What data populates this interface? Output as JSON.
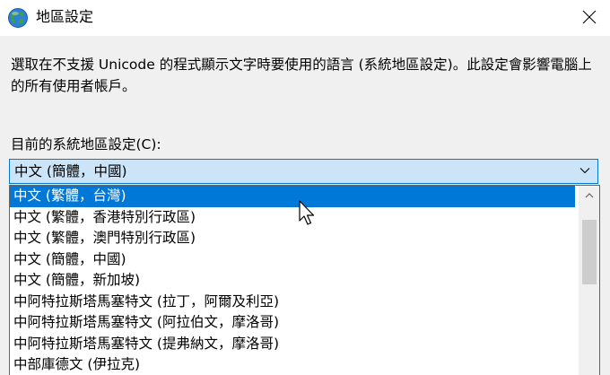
{
  "window": {
    "title": "地區設定",
    "app_icon": "globe-icon",
    "close_icon": "close-icon"
  },
  "description": "選取在不支援 Unicode 的程式顯示文字時要使用的語言 (系統地區設定)。此設定會影響電腦上的所有使用者帳戶。",
  "combo": {
    "label": "目前的系統地區設定(C):",
    "value": "中文 (簡體，中國)",
    "arrow_icon": "chevron-down-icon"
  },
  "dropdown": {
    "selected_index": 0,
    "options": [
      "中文 (繁體，台灣)",
      "中文 (繁體，香港特別行政區)",
      "中文 (繁體，澳門特別行政區)",
      "中文 (簡體，中國)",
      "中文 (簡體，新加坡)",
      "中阿特拉斯塔馬塞特文 (拉丁，阿爾及利亞)",
      "中阿特拉斯塔馬塞特文 (阿拉伯文，摩洛哥)",
      "中阿特拉斯塔馬塞特文 (提弗納文，摩洛哥)",
      "中部庫德文 (伊拉克)"
    ]
  },
  "scrollbar": {
    "up_icon": "scroll-up-arrow-icon"
  },
  "colors": {
    "accent": "#0078d7",
    "combo_background": "#cce4f7",
    "window_background": "#f0f0f0",
    "titlebar_background": "#ffffff",
    "scroll_thumb": "#cdcdcd"
  }
}
